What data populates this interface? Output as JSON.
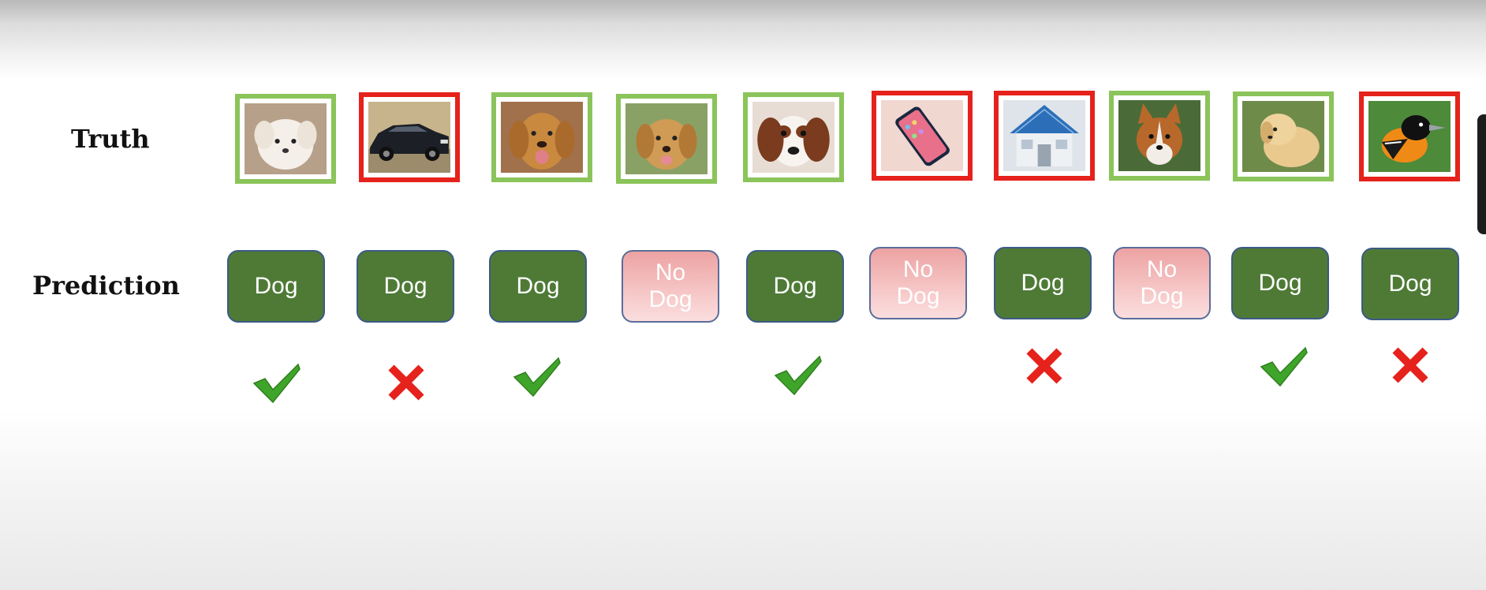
{
  "labels": {
    "truth": "Truth",
    "prediction": "Prediction"
  },
  "colors": {
    "positive_border": "#8bc45a",
    "negative_border": "#e5221b",
    "dog_box": "#4e7a36",
    "nodog_box": "#f2b7b7",
    "check": "#3fa52a",
    "cross": "#e5221b"
  },
  "items": [
    {
      "truth_image": "white-puppy",
      "truth": "dog",
      "prediction": "Dog",
      "result": "correct"
    },
    {
      "truth_image": "black-car",
      "truth": "not-dog",
      "prediction": "Dog",
      "result": "wrong"
    },
    {
      "truth_image": "golden-retriever",
      "truth": "dog",
      "prediction": "Dog",
      "result": "correct"
    },
    {
      "truth_image": "golden-retriever-outdoor",
      "truth": "dog",
      "prediction": "No Dog",
      "result": "none"
    },
    {
      "truth_image": "spaniel",
      "truth": "dog",
      "prediction": "Dog",
      "result": "correct"
    },
    {
      "truth_image": "smartphone",
      "truth": "not-dog",
      "prediction": "No Dog",
      "result": "none"
    },
    {
      "truth_image": "house",
      "truth": "not-dog",
      "prediction": "Dog",
      "result": "wrong"
    },
    {
      "truth_image": "corgi",
      "truth": "dog",
      "prediction": "No Dog",
      "result": "none"
    },
    {
      "truth_image": "golden-puppy",
      "truth": "dog",
      "prediction": "Dog",
      "result": "correct"
    },
    {
      "truth_image": "oriole-bird",
      "truth": "not-dog",
      "prediction": "Dog",
      "result": "wrong"
    }
  ],
  "pred_text": {
    "dog": "Dog",
    "nodog_line1": "No",
    "nodog_line2": "Dog"
  }
}
